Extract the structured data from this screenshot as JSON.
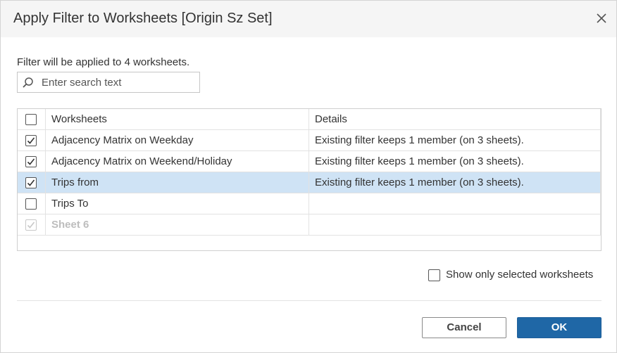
{
  "dialog": {
    "title": "Apply Filter to Worksheets [Origin Sz Set]",
    "close_icon": "close-icon"
  },
  "info_text": "Filter will be applied to 4 worksheets.",
  "search": {
    "placeholder": "Enter search text",
    "value": "",
    "icon": "search-icon"
  },
  "table": {
    "columns": {
      "worksheets": "Worksheets",
      "details": "Details"
    },
    "header_checked": false,
    "rows": [
      {
        "worksheet": "Adjacency Matrix on Weekday",
        "details": "Existing filter keeps 1 member (on 3 sheets).",
        "checked": true,
        "selected": false,
        "disabled": false
      },
      {
        "worksheet": "Adjacency Matrix on Weekend/Holiday",
        "details": "Existing filter keeps 1 member (on 3 sheets).",
        "checked": true,
        "selected": false,
        "disabled": false
      },
      {
        "worksheet": "Trips from",
        "details": "Existing filter keeps 1 member (on 3 sheets).",
        "checked": true,
        "selected": true,
        "disabled": false
      },
      {
        "worksheet": "Trips To",
        "details": "",
        "checked": false,
        "selected": false,
        "disabled": false
      },
      {
        "worksheet": "Sheet 6",
        "details": "",
        "checked": true,
        "selected": false,
        "disabled": true
      }
    ]
  },
  "show_only_selected": {
    "label": "Show only selected worksheets",
    "checked": false
  },
  "buttons": {
    "cancel": "Cancel",
    "ok": "OK"
  },
  "colors": {
    "accent": "#1f67a6",
    "selected_row": "#cfe3f5",
    "title_bar": "#f5f5f5"
  }
}
